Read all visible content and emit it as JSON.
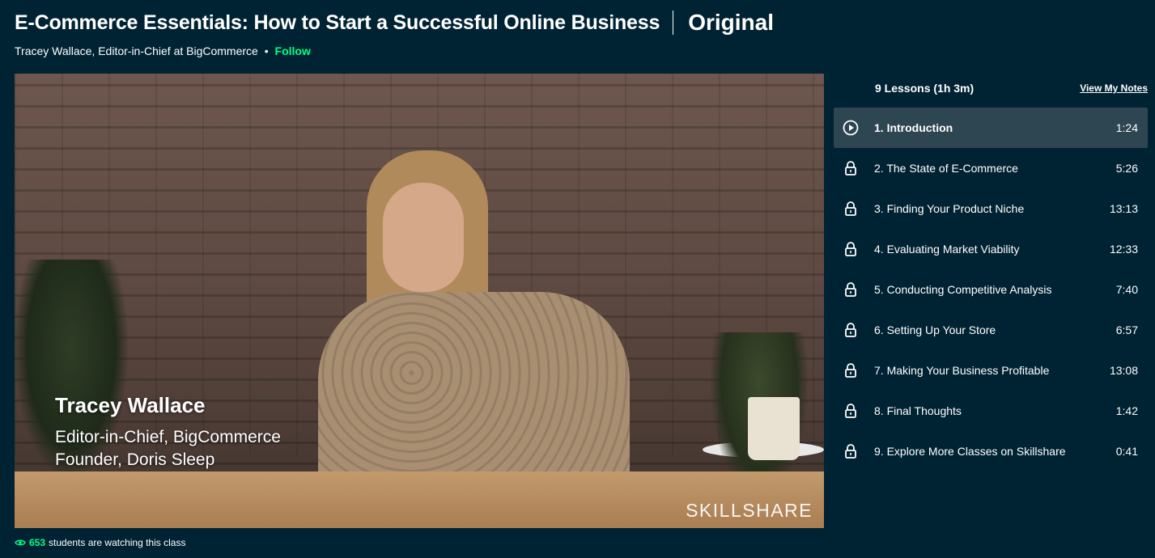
{
  "header": {
    "title": "E-Commerce Essentials: How to Start a Successful Online Business",
    "badge": "Original",
    "teacher": "Tracey Wallace, Editor-in-Chief at BigCommerce",
    "separator": "•",
    "follow_label": "Follow"
  },
  "video": {
    "lower_third": {
      "name": "Tracey Wallace",
      "line1": "Editor-in-Chief, BigCommerce",
      "line2": "Founder, Doris Sleep"
    },
    "watermark": "SKILLSHARE"
  },
  "watching": {
    "count": "653",
    "suffix": "students are watching this class"
  },
  "lessons_panel": {
    "count_label": "9 Lessons (1h 3m)",
    "notes_label": "View My Notes",
    "lessons": [
      {
        "title": "1. Introduction",
        "duration": "1:24",
        "state": "playing"
      },
      {
        "title": "2. The State of E-Commerce",
        "duration": "5:26",
        "state": "locked"
      },
      {
        "title": "3. Finding Your Product Niche",
        "duration": "13:13",
        "state": "locked"
      },
      {
        "title": "4. Evaluating Market Viability",
        "duration": "12:33",
        "state": "locked"
      },
      {
        "title": "5. Conducting Competitive Analysis",
        "duration": "7:40",
        "state": "locked"
      },
      {
        "title": "6. Setting Up Your Store",
        "duration": "6:57",
        "state": "locked"
      },
      {
        "title": "7. Making Your Business Profitable",
        "duration": "13:08",
        "state": "locked"
      },
      {
        "title": "8. Final Thoughts",
        "duration": "1:42",
        "state": "locked"
      },
      {
        "title": "9. Explore More Classes on Skillshare",
        "duration": "0:41",
        "state": "locked"
      }
    ]
  },
  "colors": {
    "background": "#002333",
    "accent_green": "#00ff84",
    "active_row": "#2e4552"
  },
  "icons": {
    "play": "play-circle-icon",
    "lock": "lock-icon",
    "eye": "eye-icon"
  }
}
